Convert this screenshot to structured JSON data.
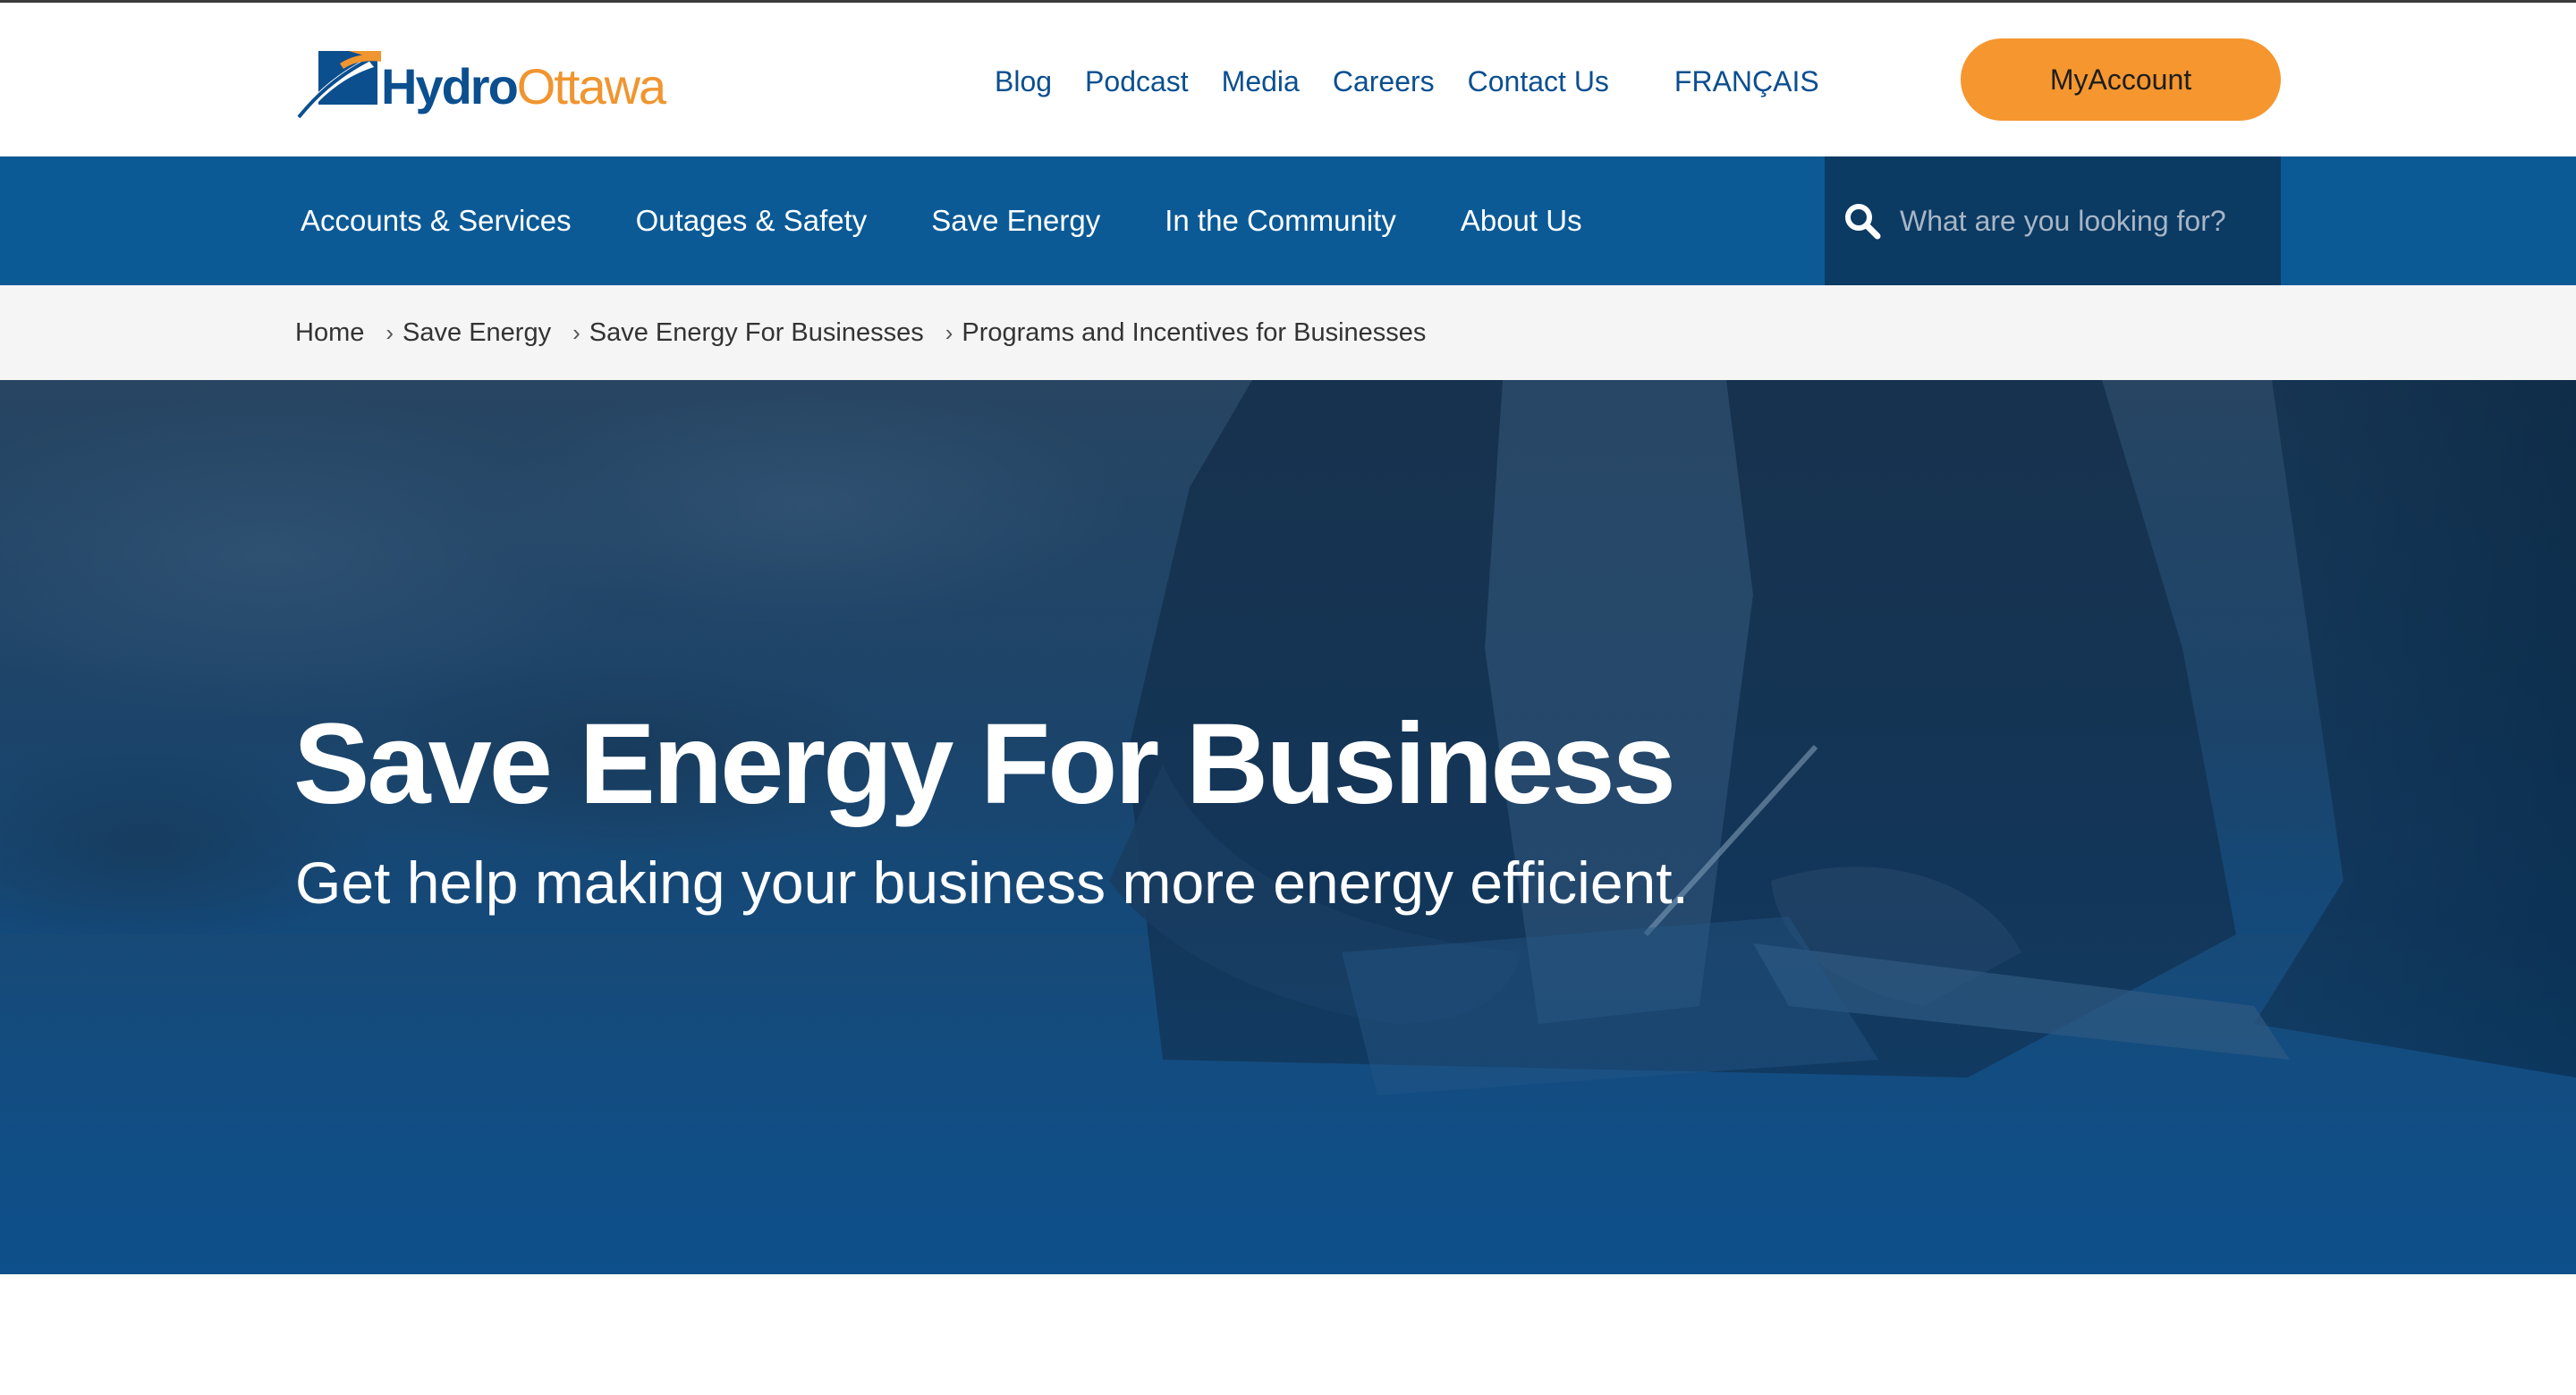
{
  "brand": {
    "logo_primary": "Hydro",
    "logo_secondary": "Ottawa",
    "colors": {
      "blue": "#0b4f8f",
      "orange": "#f5962f",
      "nav_blue": "#0b5a96",
      "search_dark": "#0b3a63"
    }
  },
  "utility_nav": {
    "items": [
      "Blog",
      "Podcast",
      "Media",
      "Careers",
      "Contact Us"
    ],
    "language": "FRANÇAIS",
    "account_button": "MyAccount"
  },
  "main_nav": {
    "items": [
      "Accounts & Services",
      "Outages & Safety",
      "Save Energy",
      "In the Community",
      "About Us"
    ]
  },
  "search": {
    "placeholder": "What are you looking for?",
    "icon": "search-icon"
  },
  "breadcrumb": {
    "items": [
      "Home",
      "Save Energy",
      "Save Energy For Businesses",
      "Programs and Incentives for Businesses"
    ],
    "separator_icon": "chevron-right-icon"
  },
  "hero": {
    "title": "Save Energy For Business",
    "subtitle": "Get help making your business more energy efficient."
  }
}
